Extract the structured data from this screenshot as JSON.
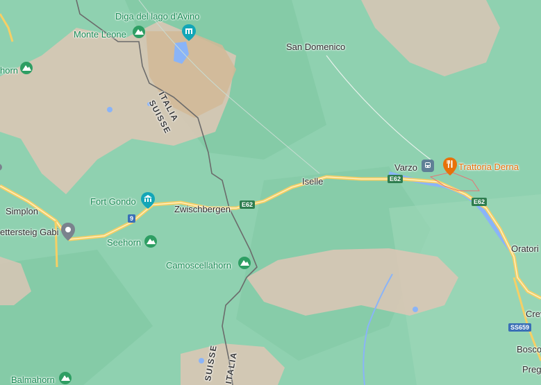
{
  "map": {
    "places": {
      "san_domenico": "San Domenico",
      "varzo": "Varzo",
      "iselle": "Iselle",
      "zwischbergen": "Zwischbergen",
      "simplon": "Simplon",
      "oratorio": "Oratori",
      "crevola": "Crev",
      "bosco": "Bosco",
      "preglia": "Preg",
      "ettersteig": "ettersteig Gabi"
    },
    "pois": {
      "diga": "Diga del lago d'Avino",
      "monte_leone": "Monte Leone",
      "hornhorn": "horn",
      "fort_gondo": "Fort Gondo",
      "seehorn": "Seehorn",
      "camoscellahorn": "Camoscellahorn",
      "balmahorn": "Balmahorn",
      "trattoria": "Trattoria Derna"
    },
    "borders": {
      "italia1": "ITALIA",
      "suisse1": "SUISSE",
      "suisse2": "SUISSE",
      "italia2": "ITALIA"
    },
    "shields": {
      "e62_a": "E62",
      "e62_b": "E62",
      "e62_c": "E62",
      "r9": "9",
      "ss659": "SS659"
    },
    "icons": [
      "mountain-icon",
      "monument-icon",
      "restaurant-icon",
      "train-icon",
      "location-pin-icon"
    ],
    "colors": {
      "terrain_green": "#8fd1b0",
      "highland_tan": "#d9c6b5",
      "road_yellow": "#f6cf65",
      "water_blue": "#8ab4f8",
      "restaurant_orange": "#e8710a",
      "park_green": "#2e9e63"
    }
  }
}
